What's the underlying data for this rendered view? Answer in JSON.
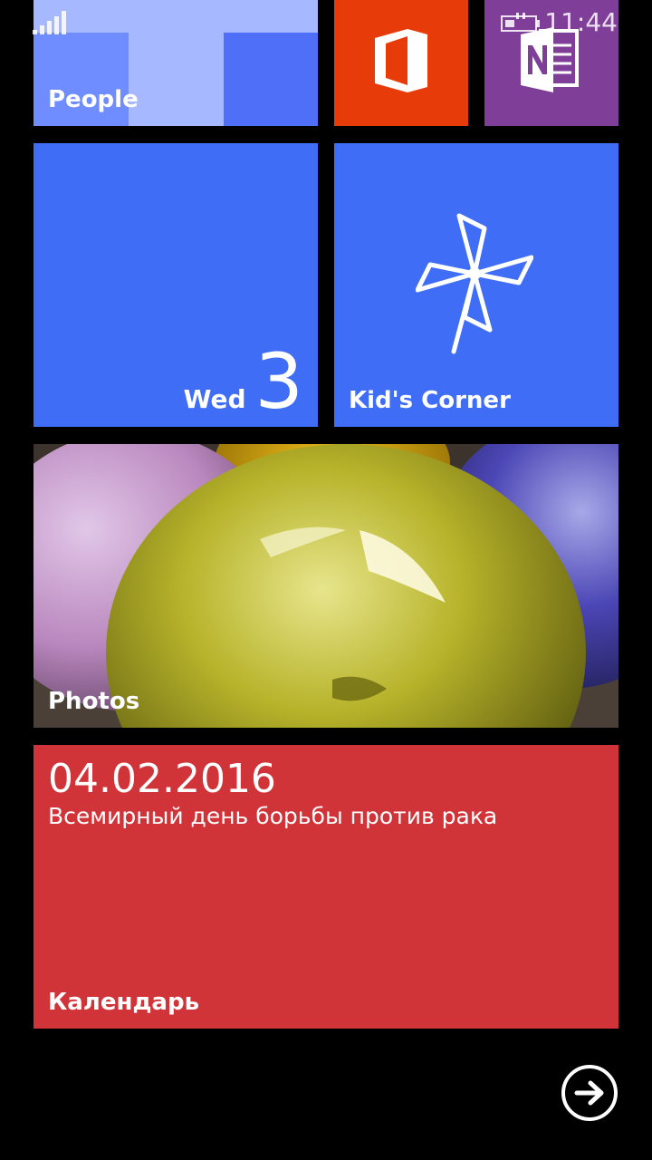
{
  "status_bar": {
    "time": "11:44",
    "icons": [
      "signal-icon",
      "battery-charging-icon"
    ]
  },
  "tiles": {
    "people": {
      "label": "People",
      "color": "#5b7cff"
    },
    "office": {
      "icon": "office-icon",
      "color": "#e83b0a"
    },
    "onenote": {
      "icon": "onenote-icon",
      "color": "#7f3f98"
    },
    "calendar_small": {
      "day_of_week": "Wed",
      "day_number": "3",
      "color": "#3f6df6"
    },
    "kids_corner": {
      "label": "Kid's Corner",
      "icon": "pinwheel-icon",
      "color": "#3f6df6"
    },
    "photos": {
      "label": "Photos"
    },
    "calendar_wide": {
      "event_date": "04.02.2016",
      "event_title": "Всемирный день борьбы против рака",
      "label": "Календарь",
      "color": "#d13438"
    }
  },
  "all_apps_button": {
    "icon": "arrow-right-circle-icon"
  }
}
